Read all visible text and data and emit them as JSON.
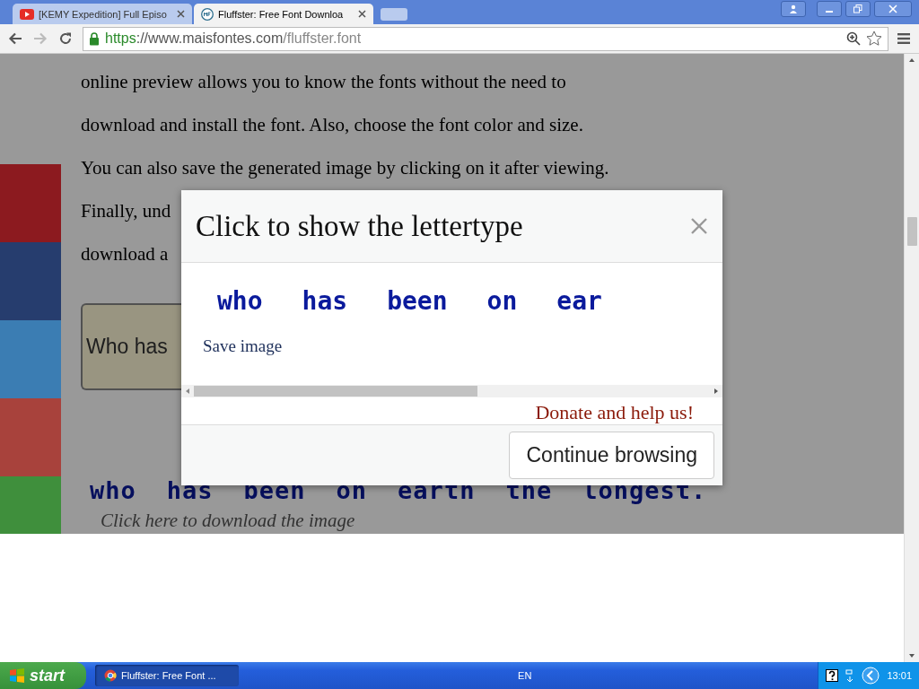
{
  "browser": {
    "tabs": [
      {
        "title": "[KEMY Expedition] Full Episo",
        "selected": false,
        "kind": "video"
      },
      {
        "title": "Fluffster: Free Font Downloa",
        "selected": true,
        "kind": "site"
      }
    ],
    "url": {
      "scheme": "https",
      "rest": "://www.maisfontes.com",
      "path": "/fluffster.font"
    }
  },
  "page": {
    "paragraph_lines": [
      "online preview allows you to know the fonts without the need to",
      "download and install the font. Also, choose the font color and size.",
      "You can also save the generated image by clicking on it after viewing.",
      "Finally, und",
      "download a"
    ],
    "side_buttons": [
      {
        "color": "#8c1a1f"
      },
      {
        "color": "#263d6e"
      },
      {
        "color": "#3b7db3"
      },
      {
        "color": "#a8423c"
      },
      {
        "color": "#3f8f3c"
      }
    ],
    "text_field_value": "Who has",
    "font_preview": [
      "who",
      "has",
      "been",
      "on",
      "earth",
      "the",
      "longest."
    ],
    "download_link": "Click here to download the image"
  },
  "modal": {
    "title": "Click to show the lettertype",
    "preview_words": [
      "who",
      "has",
      "been",
      "on",
      "ear"
    ],
    "save_link": "Save image",
    "donate_link": "Donate and help us!",
    "button": "Continue browsing"
  },
  "taskbar": {
    "start": "start",
    "windows": [
      {
        "title": "Fluffster: Free Font ...",
        "selected": true
      }
    ],
    "language": "EN",
    "time": "13:01"
  }
}
